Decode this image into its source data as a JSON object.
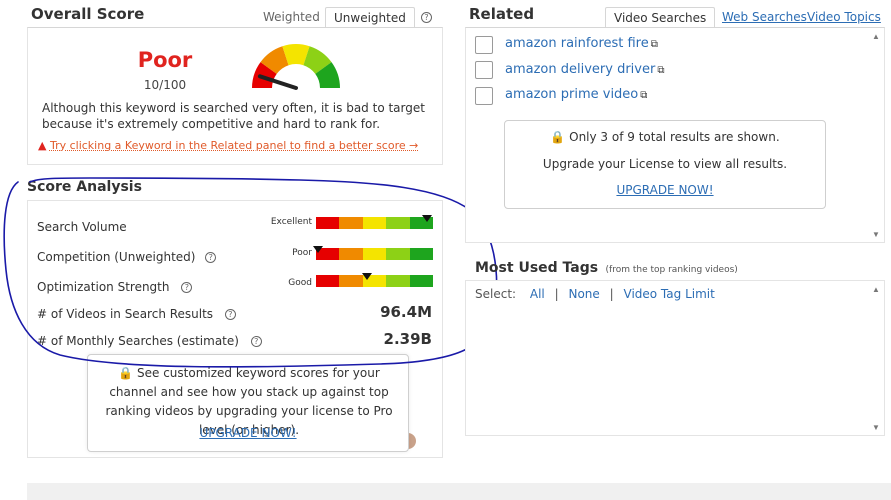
{
  "overall": {
    "title": "Overall Score",
    "tab_weighted": "Weighted",
    "tab_unweighted": "Unweighted",
    "rating": "Poor",
    "score": "10/100",
    "description": "Although this keyword is searched very often, it is bad to target because it's extremely competitive and hard to rank for.",
    "warning": "Try clicking a Keyword in the Related panel to find a better score →",
    "gauge_value_percent": 10
  },
  "analysis": {
    "title": "Score Analysis",
    "rows": [
      {
        "label": "Search Volume",
        "scale": "Excellent",
        "level": 0.95
      },
      {
        "label": "Competition (Unweighted)",
        "scale": "Poor",
        "level": 0.02
      },
      {
        "label": "Optimization Strength",
        "scale": "Good",
        "level": 0.44
      }
    ],
    "stats": [
      {
        "label": "# of Videos in Search Results",
        "value": "96.4M"
      },
      {
        "label": "# of Monthly Searches (estimate)",
        "value": "2.39B"
      }
    ],
    "upsell_text": "See customized keyword scores for your channel and see how you stack up against top ranking videos by upgrading your license to Pro level (or higher).",
    "upsell_link": "UPGRADE NOW!"
  },
  "related": {
    "title": "Related",
    "tabs": [
      "Video Searches",
      "Web Searches",
      "Video Topics"
    ],
    "items": [
      "amazon rainforest fire",
      "amazon delivery driver",
      "amazon prime video"
    ],
    "notice": "Only 3 of 9 total results are shown.",
    "notice_sub": "Upgrade your License to view all results.",
    "upgrade": "UPGRADE NOW!"
  },
  "tags": {
    "title": "Most Used Tags",
    "subtitle": "(from the top ranking videos)",
    "select_label": "Select:",
    "all": "All",
    "none": "None",
    "limit": "Video Tag Limit",
    "separator": "|"
  },
  "colors": {
    "poor_red": "#e0241f",
    "link_blue": "#2c6db4",
    "annotation_blue": "#1a1aa8"
  },
  "icons": [
    "external-link-icon",
    "lock-icon",
    "warning-icon",
    "info-icon",
    "chevron-up-icon",
    "chevron-down-icon"
  ]
}
